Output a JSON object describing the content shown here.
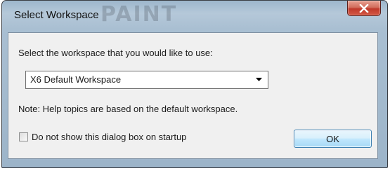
{
  "window": {
    "title": "Select Workspace",
    "titlebar_art_text": "PAINT"
  },
  "dialog": {
    "prompt": "Select the workspace that you would like to use:",
    "workspace_select": {
      "selected": "X6 Default Workspace"
    },
    "note": "Note: Help topics are based on the default workspace.",
    "startup_checkbox": {
      "label": "Do not show this dialog box on startup",
      "checked": false
    },
    "ok_label": "OK"
  },
  "icons": {
    "close": "close-icon",
    "dropdown": "chevron-down-icon"
  },
  "colors": {
    "close_button": "#c0392b",
    "ok_border": "#3c7fb1",
    "content_bg": "#f0f0f0"
  }
}
